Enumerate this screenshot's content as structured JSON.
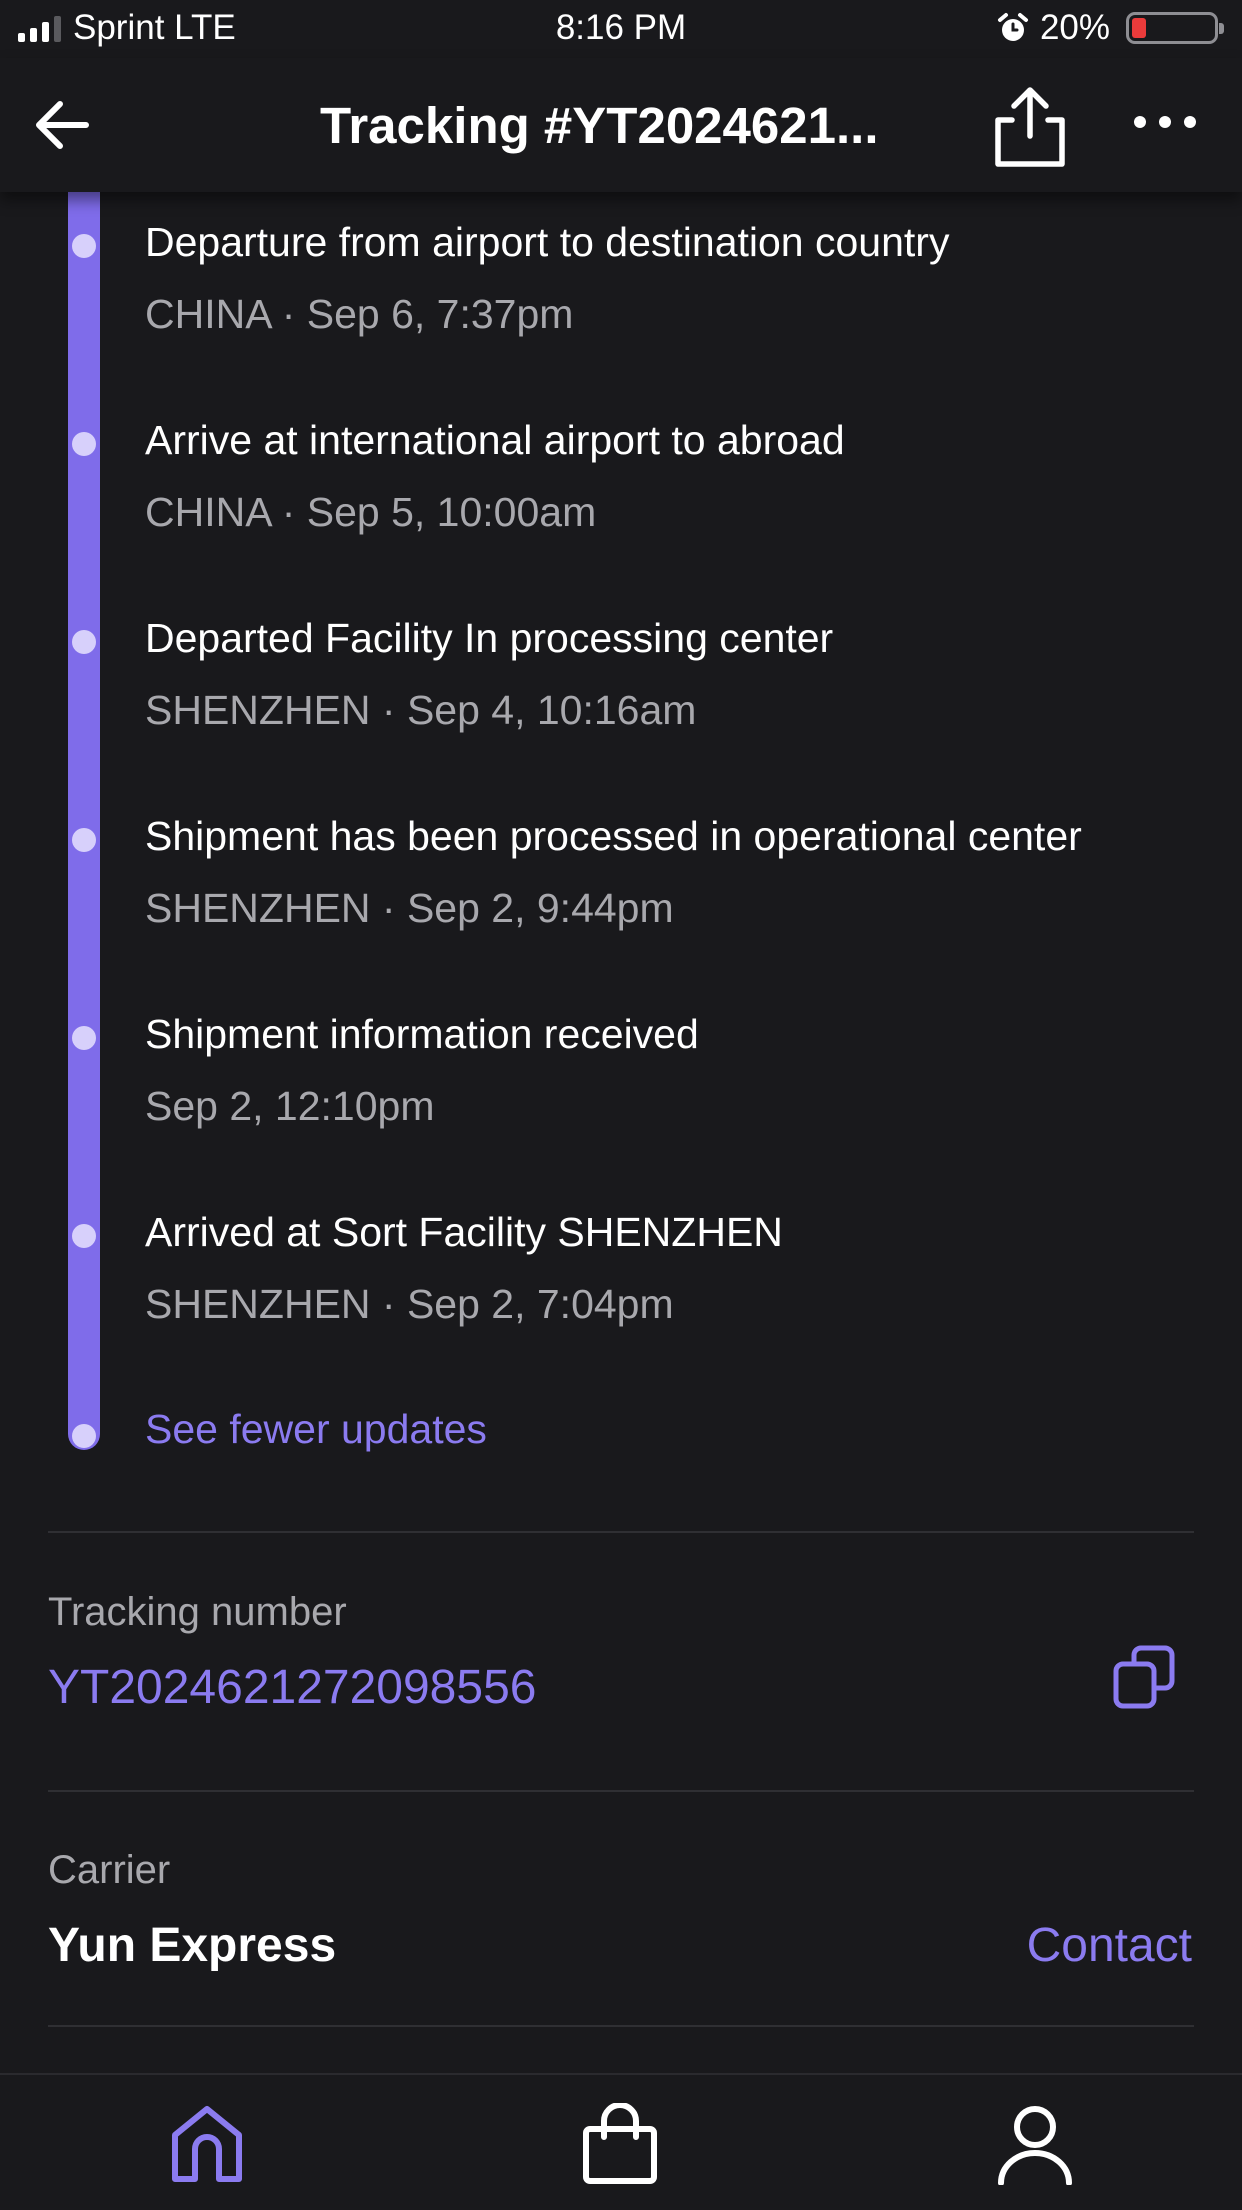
{
  "status_bar": {
    "carrier": "Sprint LTE",
    "time": "8:16 PM",
    "battery": "20%"
  },
  "nav": {
    "title": "Tracking #YT2024621..."
  },
  "timeline": {
    "events": [
      {
        "title": "Departure from airport to destination country",
        "meta": "CHINA · Sep 6, 7:37pm"
      },
      {
        "title": "Arrive at international airport to abroad",
        "meta": "CHINA · Sep 5, 10:00am"
      },
      {
        "title": "Departed Facility In processing center",
        "meta": "SHENZHEN · Sep 4, 10:16am"
      },
      {
        "title": "Shipment has been processed in operational center",
        "meta": "SHENZHEN · Sep 2, 9:44pm"
      },
      {
        "title": "Shipment information received",
        "meta": "Sep 2, 12:10pm"
      },
      {
        "title": "Arrived at Sort Facility SHENZHEN",
        "meta": "SHENZHEN · Sep 2, 7:04pm"
      }
    ],
    "see_fewer_label": "See fewer updates"
  },
  "tracking": {
    "label": "Tracking number",
    "value": "YT2024621272098556",
    "copy_icon": "copy-icon"
  },
  "carrier": {
    "label": "Carrier",
    "name": "Yun Express",
    "contact_label": "Contact"
  },
  "tab_bar": {
    "items": [
      {
        "icon": "home-icon",
        "active": true
      },
      {
        "icon": "shopping-bag-icon",
        "active": false
      },
      {
        "icon": "profile-icon",
        "active": false
      }
    ]
  },
  "colors": {
    "background": "#19191c",
    "accent": "#8b7bf0",
    "rail": "#7f6cea",
    "secondary_text": "#a8a8ad"
  }
}
